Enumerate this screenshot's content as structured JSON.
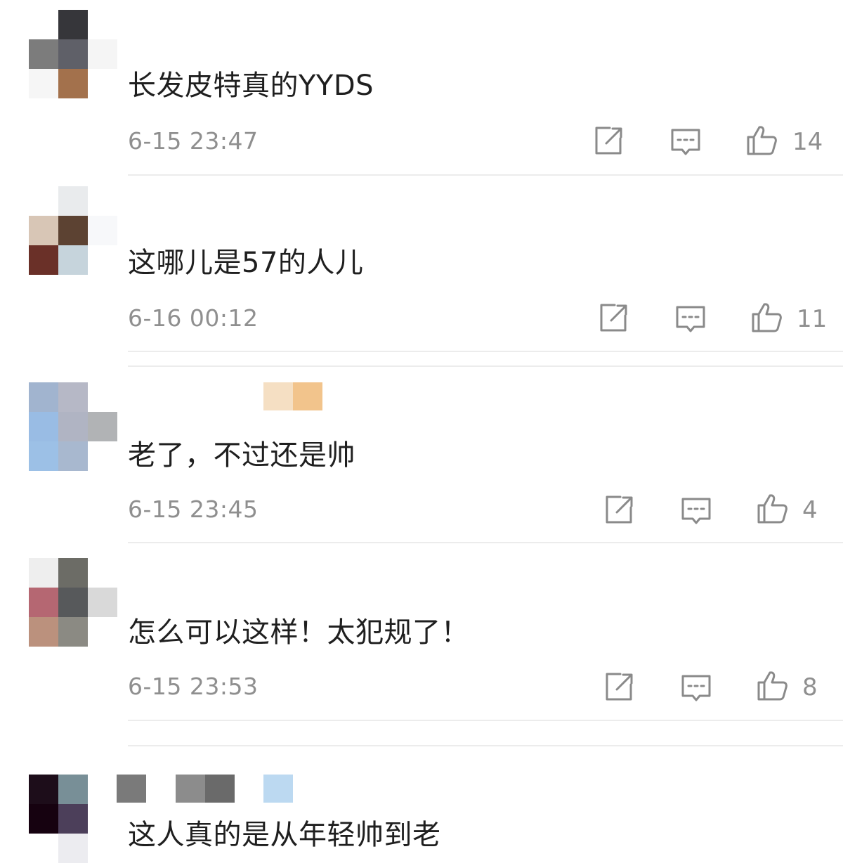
{
  "comments": [
    {
      "text": "长发皮特真的YYDS",
      "time": "6-15 23:47",
      "likes": "14"
    },
    {
      "text": "这哪儿是57的人儿",
      "time": "6-16 00:12",
      "likes": "11"
    },
    {
      "text": "老了，不过还是帅",
      "time": "6-15 23:45",
      "likes": "4"
    },
    {
      "text": "怎么可以这样！太犯规了！",
      "time": "6-15 23:53",
      "likes": "8"
    },
    {
      "text": "这人真的是从年轻帅到老"
    }
  ],
  "icons": {
    "share": "share-icon",
    "reply": "comment-icon",
    "like": "thumbs-up-icon"
  },
  "colors": {
    "text": "#1f1f1f",
    "meta": "#8f8f8f",
    "divider": "#ececec"
  }
}
